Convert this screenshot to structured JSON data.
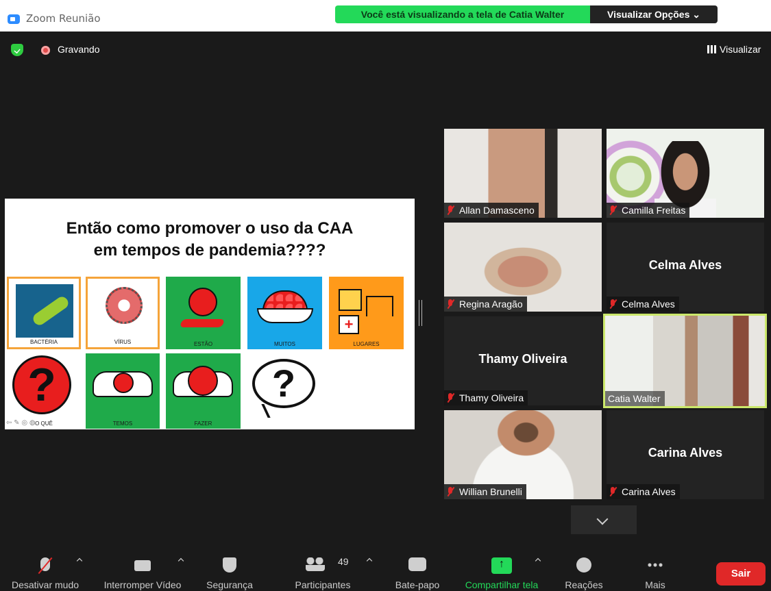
{
  "window": {
    "title": "Zoom Reunião"
  },
  "banner": {
    "sharing_text": "Você está visualizando a tela de Catia Walter",
    "view_options": "Visualizar Opções ⌄"
  },
  "status": {
    "recording_label": "Gravando",
    "view_label": "Visualizar"
  },
  "slide": {
    "title_line1": "Então como promover o uso da CAA",
    "title_line2": "em tempos de pandemia????",
    "symbols": [
      "BACTÉRIA",
      "VÍRUS",
      "ESTÃO",
      "MUITOS",
      "LUGARES",
      "O QUÊ",
      "TEMOS",
      "FAZER"
    ]
  },
  "participants_gallery": [
    {
      "name": "Allan Damasceno",
      "muted": true,
      "video": true
    },
    {
      "name": "Camilla Freitas",
      "muted": true,
      "video": true
    },
    {
      "name": "Regina Aragão",
      "muted": true,
      "video": true
    },
    {
      "name": "Celma Alves",
      "muted": true,
      "video": false
    },
    {
      "name": "Thamy Oliveira",
      "muted": true,
      "video": false
    },
    {
      "name": "Catia Walter",
      "muted": false,
      "video": true,
      "active_speaker": true
    },
    {
      "name": "Willian Brunelli",
      "muted": true,
      "video": true
    },
    {
      "name": "Carina Alves",
      "muted": true,
      "video": false
    }
  ],
  "toolbar": {
    "mute": "Desativar mudo",
    "video": "Interromper Vídeo",
    "security": "Segurança",
    "participants": "Participantes",
    "participants_count": "49",
    "chat": "Bate-papo",
    "share": "Compartilhar tela",
    "reactions": "Reações",
    "more": "Mais",
    "leave": "Sair"
  },
  "colors": {
    "share_green": "#23d959",
    "leave_red": "#e02828",
    "active_speaker_border": "#cbe86b"
  }
}
